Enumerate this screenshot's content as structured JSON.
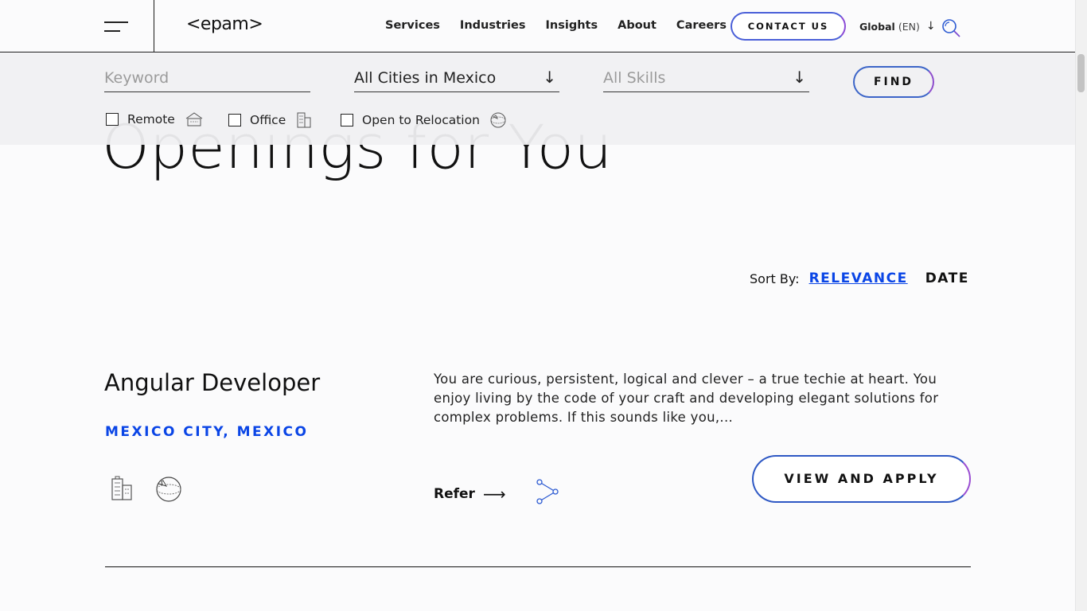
{
  "header": {
    "logo": "<epam>",
    "nav": [
      "Services",
      "Industries",
      "Insights",
      "About",
      "Careers"
    ],
    "contact_label": "CONTACT US",
    "global_label": "Global",
    "lang_label": "(EN)"
  },
  "page": {
    "heading": "Openings for You"
  },
  "filters": {
    "keyword_placeholder": "Keyword",
    "city_value": "All Cities in Mexico",
    "skills_placeholder": "All Skills",
    "find_label": "FIND",
    "remote_label": "Remote",
    "office_label": "Office",
    "relocation_label": "Open to Relocation"
  },
  "sort": {
    "label": "Sort By:",
    "relevance": "RELEVANCE",
    "date": "DATE"
  },
  "job": {
    "title": "Angular Developer",
    "location": "MEXICO CITY, MEXICO",
    "description": "You are curious, persistent, logical and clever – a true techie at heart. You enjoy living by the code of your craft and developing elegant solutions for complex problems. If this sounds like you,...",
    "refer_label": "Refer",
    "apply_label": "VIEW AND APPLY"
  },
  "colors": {
    "accent_blue": "#0a45e6",
    "gradient_start": "#3c65c8",
    "gradient_end": "#8e4dcc"
  },
  "icons": {
    "menu": "hamburger-icon",
    "search": "search-icon",
    "share": "share-icon",
    "office": "office-building-icon",
    "relocation": "relocation-globe-icon",
    "remote": "remote-house-icon"
  }
}
